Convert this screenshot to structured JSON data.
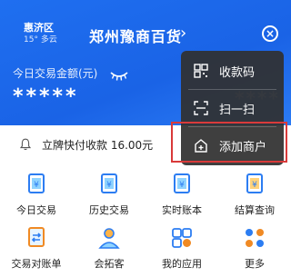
{
  "header": {
    "district": "惠济区",
    "weather": "15° 多云",
    "store_name": "郑州豫商百货",
    "amount_label": "今日交易金额(元)",
    "masked_amount": "*****",
    "masked_amount_right": "****"
  },
  "notice": {
    "text": "立牌快付收款 16.00元"
  },
  "grid": {
    "items": [
      {
        "label": "今日交易",
        "icon": "today-trade-icon"
      },
      {
        "label": "历史交易",
        "icon": "history-trade-icon"
      },
      {
        "label": "实时账本",
        "icon": "ledger-icon"
      },
      {
        "label": "结算查询",
        "icon": "settlement-icon"
      },
      {
        "label": "交易对账单",
        "icon": "reconcile-icon"
      },
      {
        "label": "会拓客",
        "icon": "customer-icon"
      },
      {
        "label": "我的应用",
        "icon": "my-apps-icon"
      },
      {
        "label": "更多",
        "icon": "more-icon"
      }
    ]
  },
  "menu": {
    "items": [
      {
        "label": "收款码",
        "icon": "qr-code-icon"
      },
      {
        "label": "扫一扫",
        "icon": "scan-icon"
      },
      {
        "label": "添加商户",
        "icon": "add-merchant-icon"
      }
    ]
  },
  "colors": {
    "header_blue": "#1a63e6",
    "menu_bg": "#303030",
    "icon_blue": "#2c7df2",
    "icon_orange": "#f08a24",
    "highlight_red": "#d93a3a"
  }
}
